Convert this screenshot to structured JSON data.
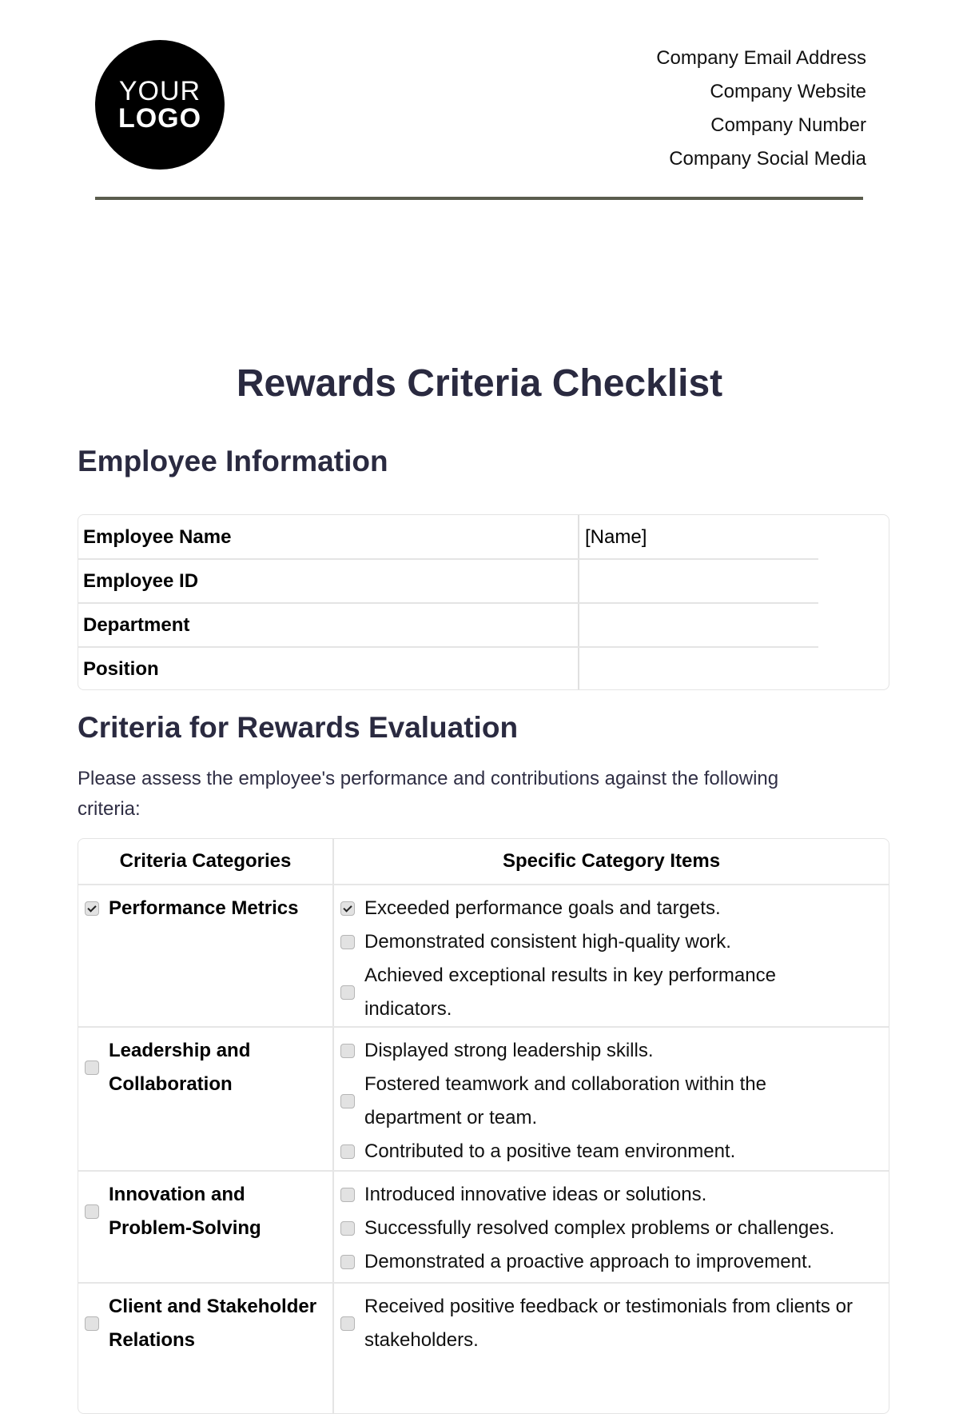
{
  "header": {
    "logo": {
      "line1": "YOUR",
      "line2": "LOGO"
    },
    "contact": [
      "Company Email Address",
      "Company Website",
      "Company Number",
      "Company Social Media"
    ]
  },
  "title": "Rewards Criteria Checklist",
  "employee_info": {
    "heading": "Employee Information",
    "rows": [
      {
        "label": "Employee Name",
        "value": "[Name]"
      },
      {
        "label": "Employee ID",
        "value": ""
      },
      {
        "label": "Department",
        "value": ""
      },
      {
        "label": "Position",
        "value": ""
      }
    ]
  },
  "criteria": {
    "heading": "Criteria for Rewards Evaluation",
    "intro": "Please assess the employee's performance and contributions against the following criteria:",
    "columns": [
      "Criteria Categories",
      "Specific Category Items"
    ],
    "rows": [
      {
        "category": "Performance Metrics",
        "checked": true,
        "items": [
          {
            "text": "Exceeded performance goals and targets.",
            "checked": true
          },
          {
            "text": "Demonstrated consistent high-quality work.",
            "checked": false
          },
          {
            "text": "Achieved exceptional results in key performance indicators.",
            "checked": false
          }
        ]
      },
      {
        "category": "Leadership and Collaboration",
        "checked": false,
        "items": [
          {
            "text": "Displayed strong leadership skills.",
            "checked": false
          },
          {
            "text": "Fostered teamwork and collaboration within the department or team.",
            "checked": false
          },
          {
            "text": "Contributed to a positive team environment.",
            "checked": false
          }
        ]
      },
      {
        "category": "Innovation and Problem-Solving",
        "checked": false,
        "items": [
          {
            "text": "Introduced innovative ideas or solutions.",
            "checked": false
          },
          {
            "text": "Successfully resolved complex problems or challenges.",
            "checked": false
          },
          {
            "text": "Demonstrated a proactive approach to improvement.",
            "checked": false
          }
        ]
      },
      {
        "category": "Client and Stakeholder Relations",
        "checked": false,
        "items": [
          {
            "text": "Received positive feedback or testimonials from clients or stakeholders.",
            "checked": false
          }
        ]
      }
    ]
  }
}
